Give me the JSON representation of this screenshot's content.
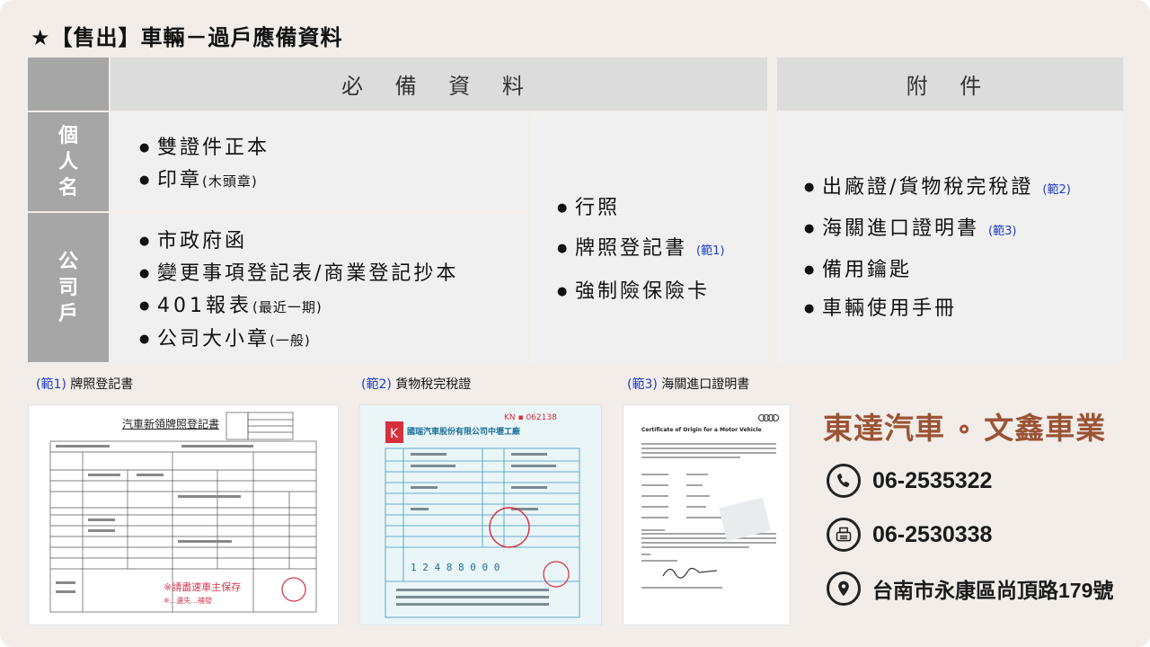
{
  "title": "★【售出】車輛－過戶應備資料",
  "table": {
    "header_required": "必 備 資 料",
    "header_attach": "附 件",
    "side_personal": [
      "個",
      "人",
      "名"
    ],
    "side_company": [
      "公",
      "司",
      "戶"
    ],
    "personal_items": [
      {
        "text": "雙證件正本",
        "note": ""
      },
      {
        "text": "印章",
        "note": "(木頭章)"
      }
    ],
    "company_items": [
      {
        "text": "市政府函",
        "note": ""
      },
      {
        "text": "變更事項登記表/商業登記抄本",
        "note": ""
      },
      {
        "text": "401報表",
        "note": "(最近一期)"
      },
      {
        "text": "公司大小章",
        "note": "(一般)"
      }
    ],
    "common_items": [
      {
        "text": "行照",
        "ref": ""
      },
      {
        "text": "牌照登記書",
        "ref": "(範1)"
      },
      {
        "text": "強制險保險卡",
        "ref": ""
      }
    ],
    "attach_items": [
      {
        "text": "出廠證/貨物稅完稅證",
        "ref": "(範2)"
      },
      {
        "text": "海關進口證明書",
        "ref": "(範3)"
      },
      {
        "text": "備用鑰匙",
        "ref": ""
      },
      {
        "text": "車輛使用手冊",
        "ref": ""
      }
    ]
  },
  "examples": [
    {
      "ref": "(範1)",
      "label": " 牌照登記書",
      "doc_title": "汽車新領牌照登記書"
    },
    {
      "ref": "(範2)",
      "label": " 貨物稅完稅證",
      "doc_title": "國瑞汽車股份有限公司中壢工廠"
    },
    {
      "ref": "(範3)",
      "label": " 海關進口證明書",
      "doc_title": "Certificate of Origin for a Motor Vehicle"
    }
  ],
  "brand": {
    "name": "東達汽車 ∘ 文鑫車業",
    "phone": "06-2535322",
    "fax": "06-2530338",
    "address": "台南市永康區尚頂路179號",
    "color": "#9b5336"
  },
  "icons": {
    "phone": "phone-icon",
    "fax": "fax-icon",
    "location": "location-pin-icon"
  }
}
